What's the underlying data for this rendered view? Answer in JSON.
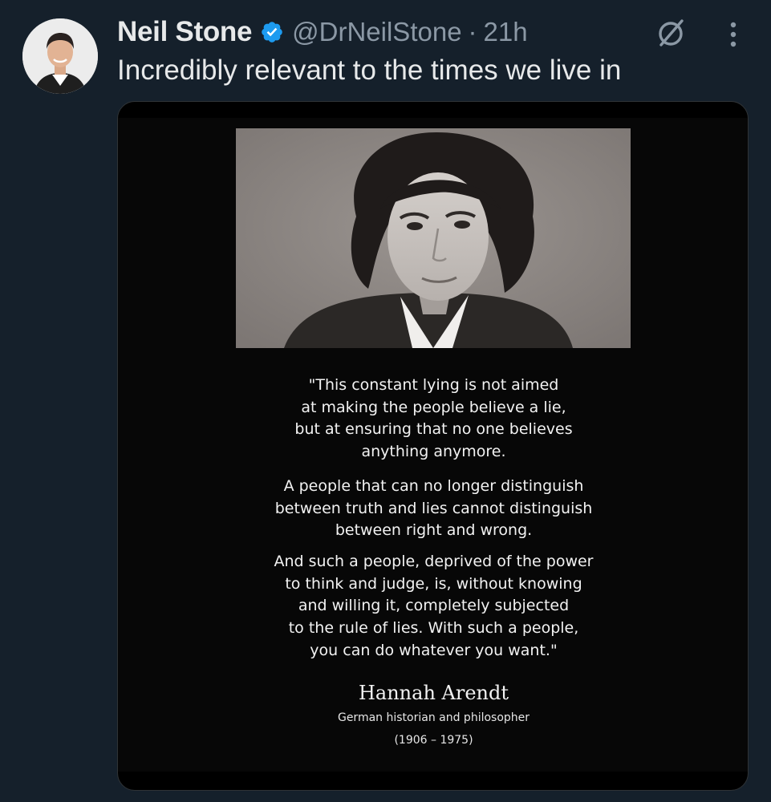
{
  "tweet": {
    "author": {
      "display_name": "Neil Stone",
      "handle": "@DrNeilStone",
      "verified": true,
      "avatar_icon": "profile-photo"
    },
    "separator": "·",
    "time": "21h",
    "text": "Incredibly relevant to the times we live in",
    "actions": {
      "grok_icon": "grok-icon",
      "more_icon": "more-vertical-icon"
    },
    "media": {
      "photo_icon": "portrait-photo",
      "quote_paragraphs": [
        [
          "\"This constant lying is not aimed",
          "at making the people believe a lie,",
          "but at ensuring that no one believes",
          "anything anymore."
        ],
        [
          "A people that can no longer distinguish",
          "between truth and lies cannot distinguish",
          "between right and wrong."
        ],
        [
          "And such a people, deprived of the power",
          "to think and judge, is, without knowing",
          "and willing it, completely subjected",
          "to the rule of lies. With such a people,",
          "you can do whatever you want.\""
        ]
      ],
      "attribution": {
        "name": "Hannah Arendt",
        "role": "German historian and philosopher",
        "years": "(1906 – 1975)"
      }
    }
  },
  "colors": {
    "background": "#15202b",
    "primary_text": "#e7e9ea",
    "secondary_text": "#8b98a5",
    "verified_badge": "#1d9bf0",
    "media_background": "#000000"
  }
}
